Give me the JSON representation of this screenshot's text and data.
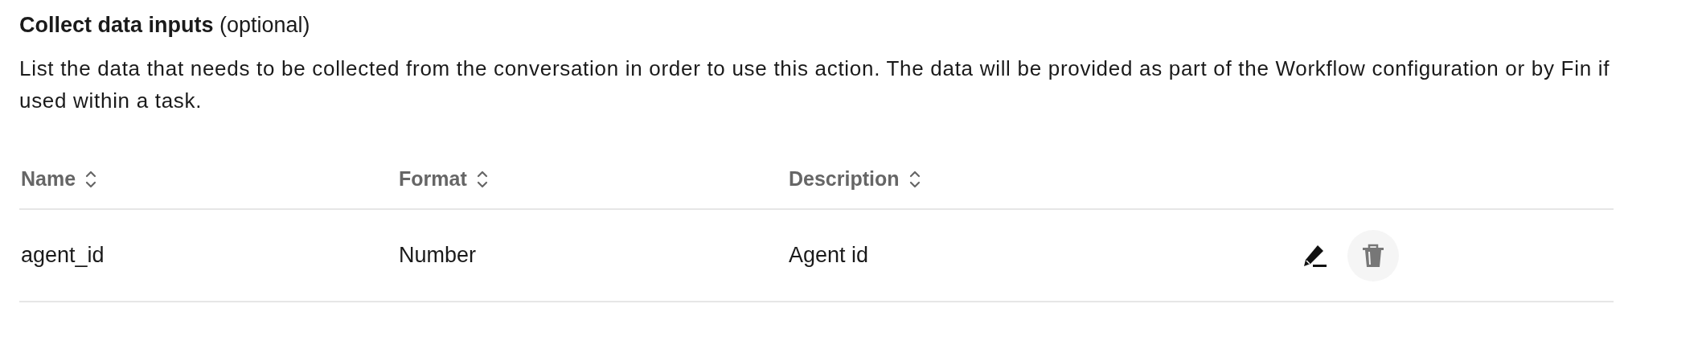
{
  "section": {
    "title": "**Collect data inputs** (optional)",
    "description": "List the data that needs to be collected from the conversation in order to use this action. The data will be provided as part of the Workflow configuration or by Fin if used within a task."
  },
  "table": {
    "columns": [
      {
        "label": "Name",
        "sortable": true
      },
      {
        "label": "Format",
        "sortable": true
      },
      {
        "label": "Description",
        "sortable": true
      }
    ],
    "rows": [
      {
        "cells": [
          "agent_id",
          "Number",
          "Agent id"
        ],
        "actions": [
          {
            "kind": "edit"
          },
          {
            "kind": "delete"
          }
        ]
      }
    ]
  }
}
